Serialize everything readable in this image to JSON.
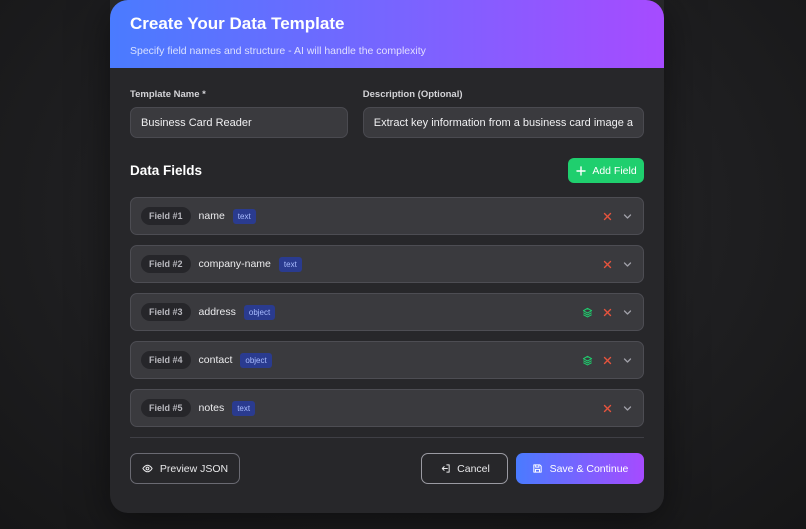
{
  "header": {
    "title": "Create Your Data Template",
    "subtitle": "Specify field names and structure - AI will handle the complexity"
  },
  "form": {
    "name_label": "Template Name *",
    "name_value": "Business Card Reader",
    "desc_label": "Description (Optional)",
    "desc_value": "Extract key information from a business card image a"
  },
  "fields_section": {
    "title": "Data Fields",
    "add_label": "Add Field",
    "items": [
      {
        "num": "Field #1",
        "name": "name",
        "type": "text",
        "nested": false
      },
      {
        "num": "Field #2",
        "name": "company-name",
        "type": "text",
        "nested": false
      },
      {
        "num": "Field #3",
        "name": "address",
        "type": "object",
        "nested": true
      },
      {
        "num": "Field #4",
        "name": "contact",
        "type": "object",
        "nested": true
      },
      {
        "num": "Field #5",
        "name": "notes",
        "type": "text",
        "nested": false
      }
    ]
  },
  "footer": {
    "preview_label": "Preview JSON",
    "cancel_label": "Cancel",
    "save_label": "Save & Continue"
  },
  "colors": {
    "gradient_start": "#4a7bff",
    "gradient_end": "#a64bff",
    "add_button": "#1fcf6e",
    "delete_icon": "#e5533d",
    "layers_icon": "#1fcf6e"
  },
  "icons": {
    "add": "plus-icon",
    "delete": "close-icon",
    "expand": "chevron-down-icon",
    "nested": "layers-icon",
    "preview": "eye-icon",
    "cancel": "exit-icon",
    "save": "floppy-disk-icon"
  }
}
